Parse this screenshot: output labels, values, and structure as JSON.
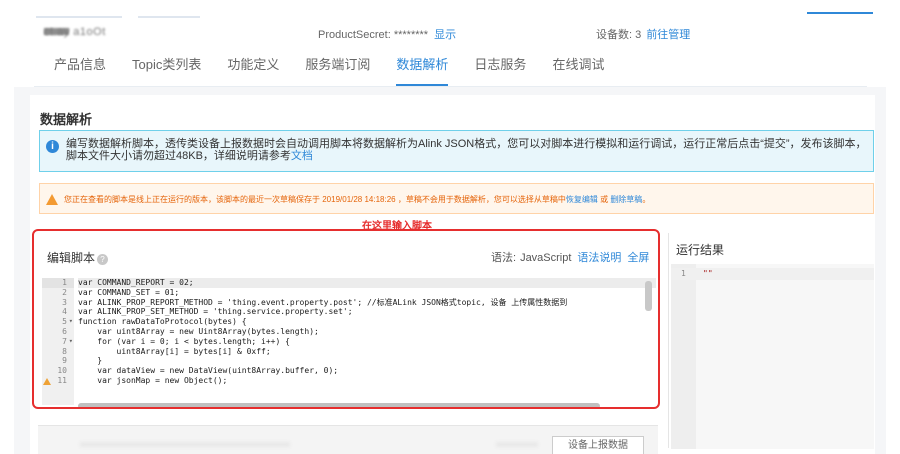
{
  "header": {
    "product_name": "ct.ay  a1oOt",
    "product_secret_label": "ProductSecret:",
    "product_secret_value": "********",
    "show_secret": "显示",
    "device_count_label": "设备数:",
    "device_count": "3",
    "manage_link": "前往管理"
  },
  "tabs": [
    "产品信息",
    "Topic类列表",
    "功能定义",
    "服务端订阅",
    "数据解析",
    "日志服务",
    "在线调试"
  ],
  "active_tab": "数据解析",
  "page": {
    "title": "数据解析",
    "info_text": "编写数据解析脚本，透传类设备上报数据时会自动调用脚本将数据解析为Alink JSON格式，您可以对脚本进行模拟和运行调试，运行正常后点击“提交”，发布该脚本，脚本文件大小请勿超过48KB，详细说明请参考",
    "doc_link": "文档",
    "warning_text": "您正在查看的脚本是线上正在运行的版本，该脚本的最近一次草稿保存于 2019/01/28 14:18:26 ，草稿不会用于数据解析，您可以选择从草稿中",
    "restore_link": "恢复编辑",
    "or_text": "或",
    "delete_link": "删除草稿",
    "warning_end": "。",
    "annotation": "在这里输入脚本"
  },
  "editor": {
    "title": "编辑脚本",
    "syntax_label": "语法:",
    "language": "JavaScript",
    "syntax_help": "语法说明",
    "fullscreen": "全屏",
    "line_numbers": [
      "1",
      "2",
      "3",
      "4",
      "5",
      "6",
      "7",
      "8",
      "9",
      "10",
      "11"
    ],
    "lines": [
      "var COMMAND_REPORT = 02;",
      "var COMMAND_SET = 01;",
      "var ALINK_PROP_REPORT_METHOD = 'thing.event.property.post'; //标准ALink JSON格式topic, 设备 上传属性数据到",
      "var ALINK_PROP_SET_METHOD = 'thing.service.property.set';",
      "function rawDataToProtocol(bytes) {",
      "    var uint8Array = new Uint8Array(bytes.length);",
      "    for (var i = 0; i < bytes.length; i++) {",
      "        uint8Array[i] = bytes[i] & 0xff;",
      "    }",
      "    var dataView = new DataView(uint8Array.buffer, 0);",
      "    var jsonMap = new Object();"
    ]
  },
  "result": {
    "title": "运行结果",
    "line_number": "1",
    "value": "\"\""
  },
  "bottom": {
    "button_label": "设备上报数据"
  }
}
